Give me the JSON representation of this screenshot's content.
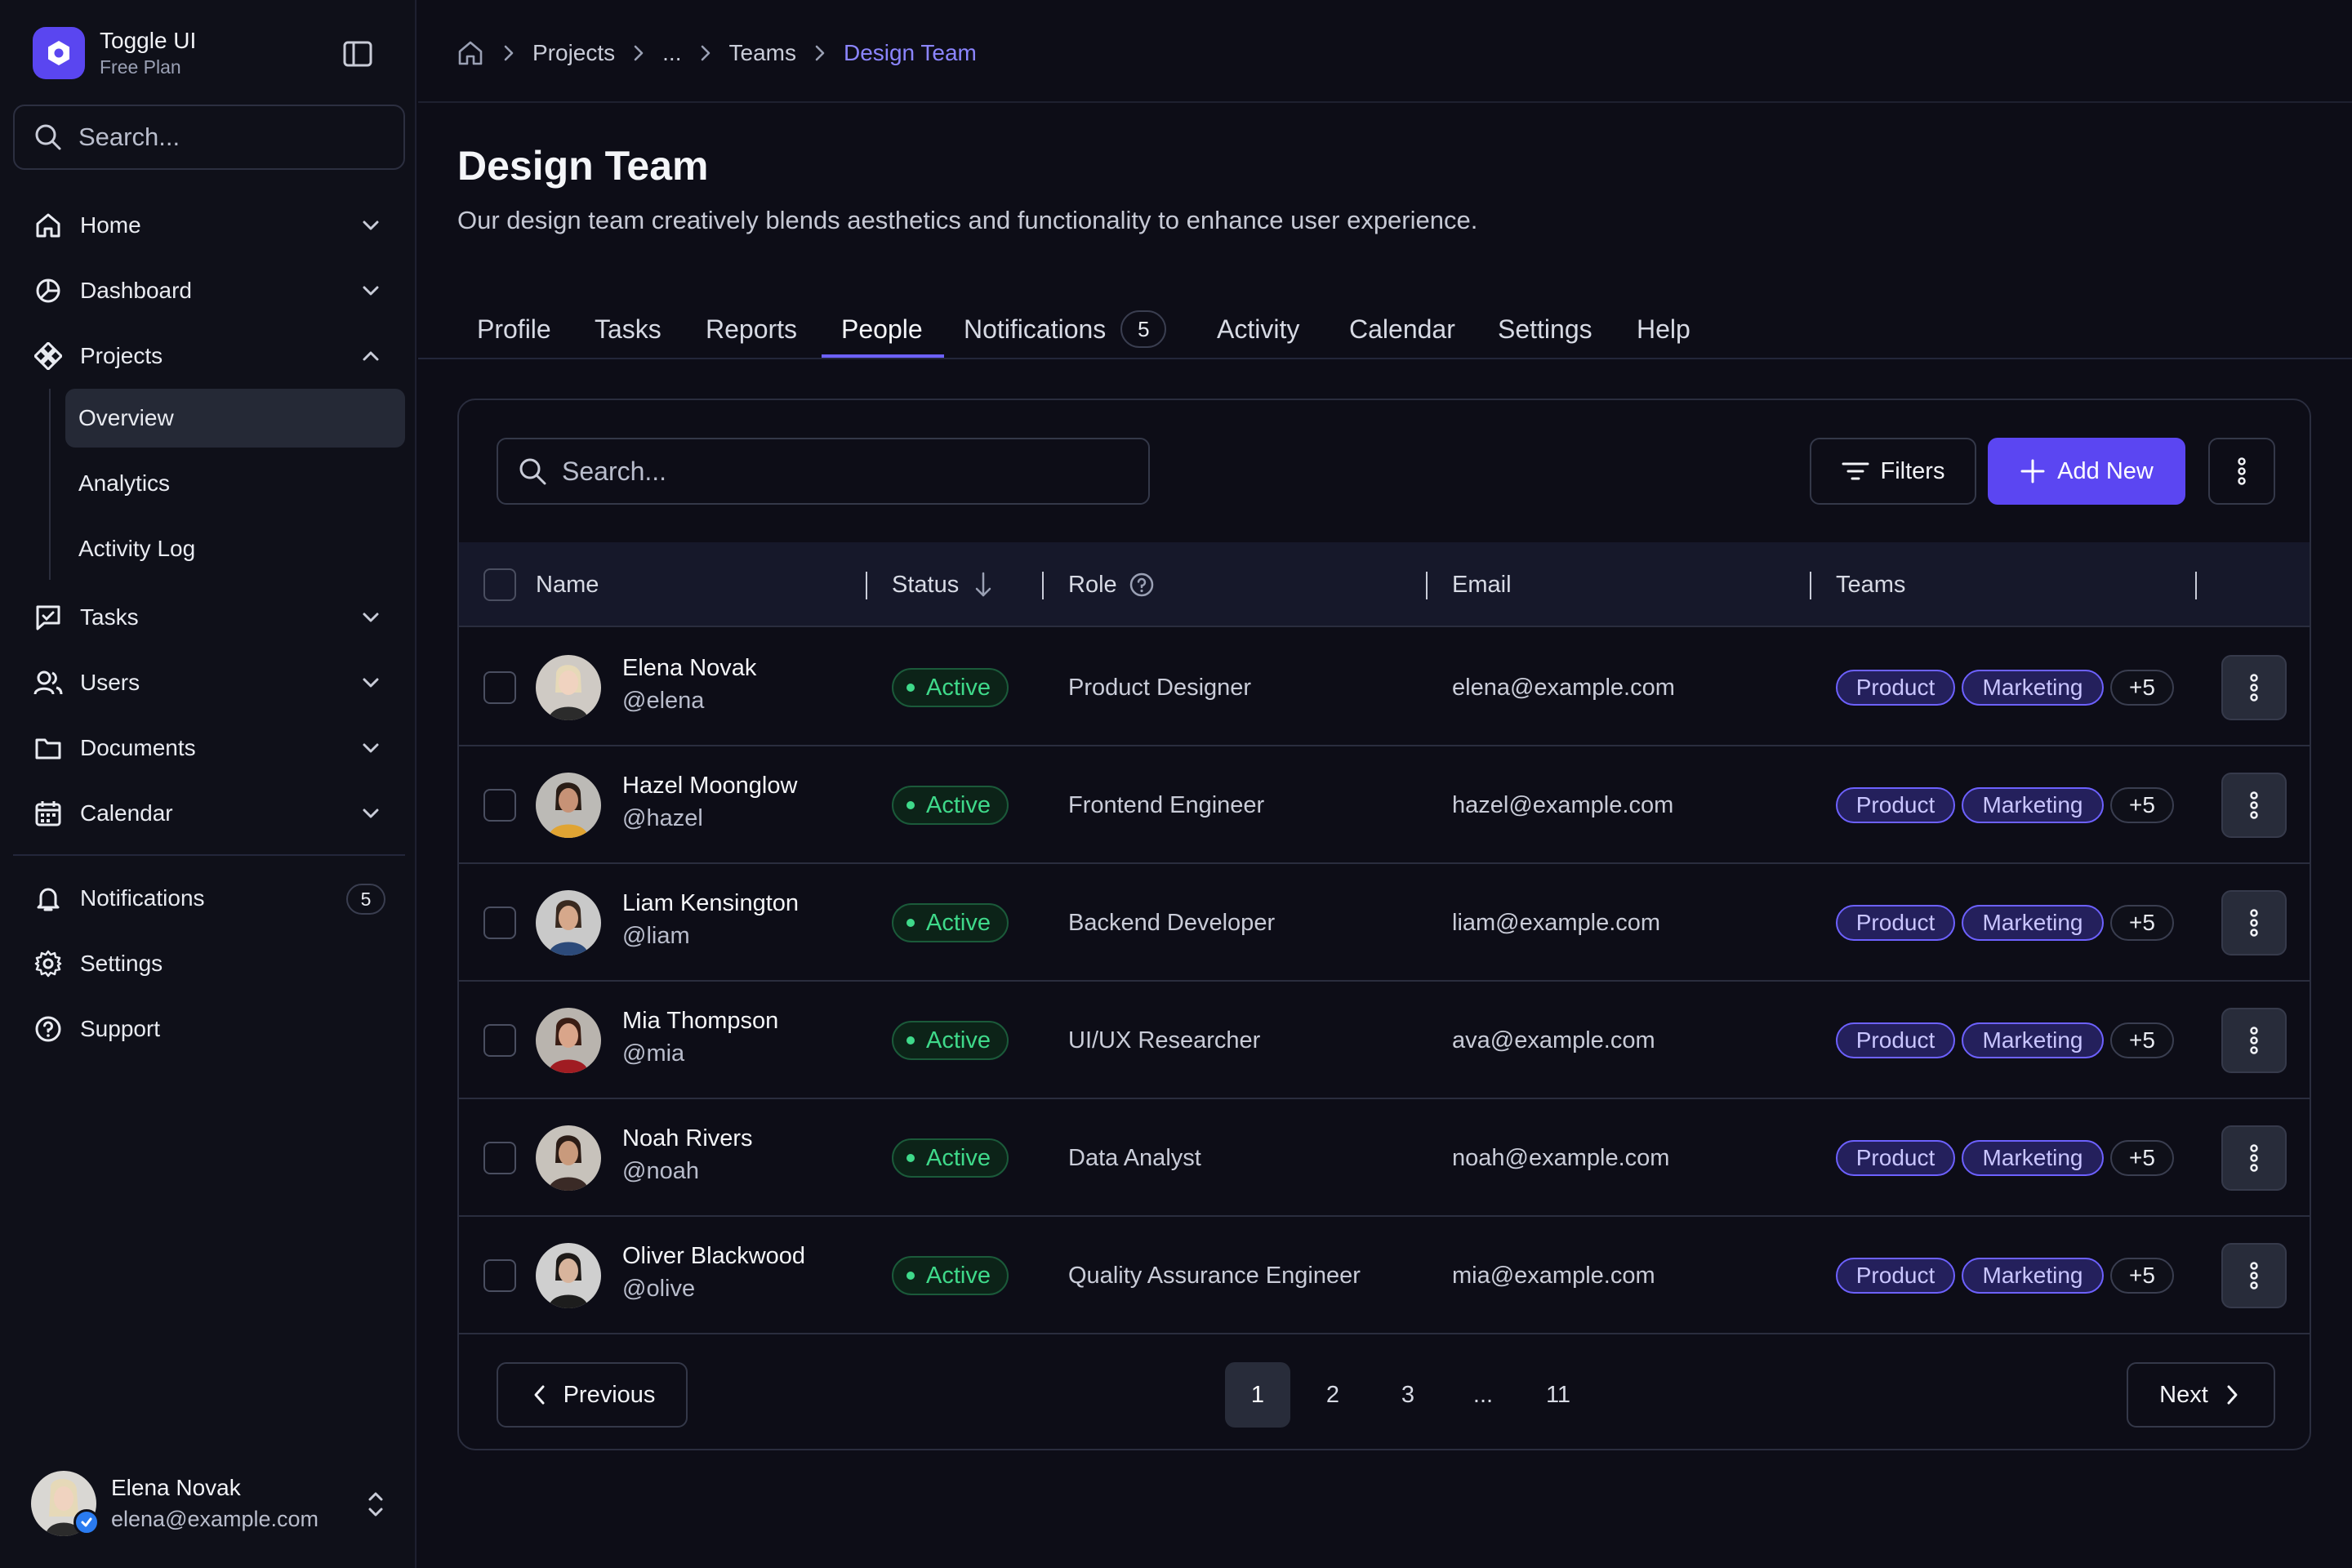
{
  "brand": {
    "name": "Toggle UI",
    "plan": "Free Plan"
  },
  "sidebar": {
    "search_placeholder": "Search...",
    "items": [
      {
        "label": "Home",
        "icon": "home-icon"
      },
      {
        "label": "Dashboard",
        "icon": "pie-chart-icon"
      },
      {
        "label": "Projects",
        "icon": "projects-icon",
        "expanded": true
      },
      {
        "label": "Tasks",
        "icon": "tasks-icon"
      },
      {
        "label": "Users",
        "icon": "users-icon"
      },
      {
        "label": "Documents",
        "icon": "folder-icon"
      },
      {
        "label": "Calendar",
        "icon": "calendar-icon"
      }
    ],
    "sub_items": [
      {
        "label": "Overview",
        "active": true
      },
      {
        "label": "Analytics"
      },
      {
        "label": "Activity Log"
      }
    ],
    "bottom_items": [
      {
        "label": "Notifications",
        "icon": "bell-icon",
        "count": "5"
      },
      {
        "label": "Settings",
        "icon": "gear-icon"
      },
      {
        "label": "Support",
        "icon": "help-circle-icon"
      }
    ],
    "user": {
      "name": "Elena Novak",
      "email": "elena@example.com"
    }
  },
  "breadcrumb": [
    "Projects",
    "...",
    "Teams",
    "Design Team"
  ],
  "page": {
    "title": "Design Team",
    "description": "Our design team creatively blends aesthetics and functionality to enhance user experience."
  },
  "tabs": [
    {
      "label": "Profile"
    },
    {
      "label": "Tasks"
    },
    {
      "label": "Reports"
    },
    {
      "label": "People",
      "active": true
    },
    {
      "label": "Notifications",
      "badge": "5"
    },
    {
      "label": "Activity"
    },
    {
      "label": "Calendar"
    },
    {
      "label": "Settings"
    },
    {
      "label": "Help"
    }
  ],
  "toolbar": {
    "search_placeholder": "Search...",
    "filters_label": "Filters",
    "add_label": "Add New"
  },
  "table": {
    "columns": [
      "Name",
      "Status",
      "Role",
      "Email",
      "Teams"
    ],
    "rows": [
      {
        "name": "Elena Novak",
        "handle": "@elena",
        "status": "Active",
        "role": "Product Designer",
        "email": "elena@example.com",
        "teams": [
          "Product",
          "Marketing"
        ],
        "more": "+5"
      },
      {
        "name": "Hazel Moonglow",
        "handle": "@hazel",
        "status": "Active",
        "role": "Frontend Engineer",
        "email": "hazel@example.com",
        "teams": [
          "Product",
          "Marketing"
        ],
        "more": "+5"
      },
      {
        "name": "Liam Kensington",
        "handle": "@liam",
        "status": "Active",
        "role": "Backend Developer",
        "email": "liam@example.com",
        "teams": [
          "Product",
          "Marketing"
        ],
        "more": "+5"
      },
      {
        "name": "Mia Thompson",
        "handle": "@mia",
        "status": "Active",
        "role": "UI/UX Researcher",
        "email": "ava@example.com",
        "teams": [
          "Product",
          "Marketing"
        ],
        "more": "+5"
      },
      {
        "name": "Noah Rivers",
        "handle": "@noah",
        "status": "Active",
        "role": "Data Analyst",
        "email": "noah@example.com",
        "teams": [
          "Product",
          "Marketing"
        ],
        "more": "+5"
      },
      {
        "name": "Oliver Blackwood",
        "handle": "@olive",
        "status": "Active",
        "role": "Quality Assurance Engineer",
        "email": "mia@example.com",
        "teams": [
          "Product",
          "Marketing"
        ],
        "more": "+5"
      }
    ]
  },
  "pagination": {
    "previous_label": "Previous",
    "next_label": "Next",
    "pages": [
      "1",
      "2",
      "3",
      "...",
      "11"
    ],
    "current": "1"
  },
  "colors": {
    "accent": "#5b46f2",
    "background": "#0d0d17",
    "status_active": "#3fd98a",
    "tag_border": "#6d61ff"
  }
}
